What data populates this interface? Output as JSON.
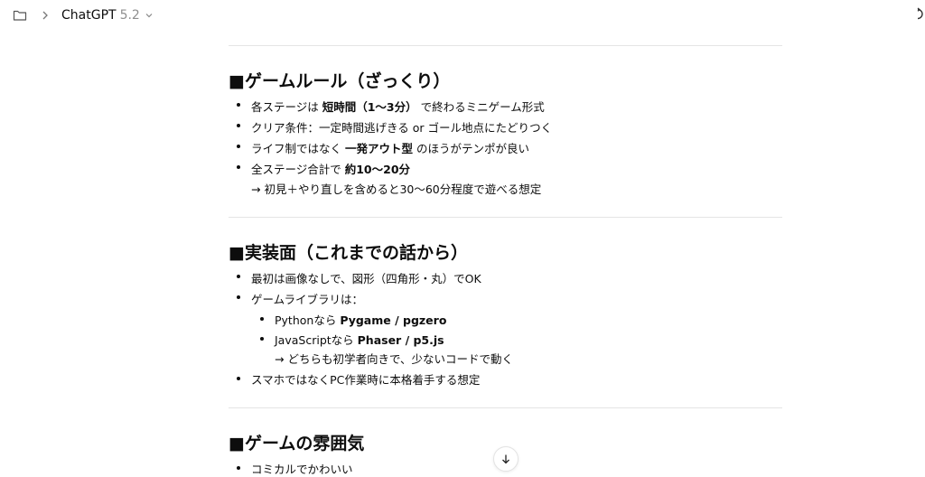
{
  "header": {
    "model_name": "ChatGPT",
    "model_version": "5.2"
  },
  "sections": [
    {
      "title": "■ゲームルール（ざっくり）",
      "items": [
        {
          "pre": "各ステージは ",
          "bold": "短時間（1〜3分）",
          "post": " で終わるミニゲーム形式"
        },
        {
          "pre": "クリア条件：一定時間逃げきる or ゴール地点にたどりつく",
          "bold": "",
          "post": ""
        },
        {
          "pre": "ライフ制ではなく ",
          "bold": "一発アウト型",
          "post": " のほうがテンポが良い"
        },
        {
          "pre": "全ステージ合計で ",
          "bold": "約10〜20分",
          "post": ""
        }
      ],
      "note": "→ 初見＋やり直しを含めると30〜60分程度で遊べる想定"
    },
    {
      "title": "■実装面（これまでの話から）",
      "items": [
        {
          "pre": "最初は画像なしで、図形（四角形・丸）でOK",
          "bold": "",
          "post": ""
        },
        {
          "pre": "ゲームライブラリは：",
          "bold": "",
          "post": ""
        }
      ],
      "subitems": [
        {
          "pre": "Pythonなら ",
          "bold": "Pygame / pgzero",
          "post": ""
        },
        {
          "pre": "JavaScriptなら ",
          "bold": "Phaser / p5.js",
          "post": ""
        }
      ],
      "subnote": "→ どちらも初学者向きで、少ないコードで動く",
      "last_item": "スマホではなくPC作業時に本格着手する想定"
    },
    {
      "title": "■ゲームの雰囲気",
      "items": [
        {
          "pre": "コミカルでかわいい",
          "bold": "",
          "post": ""
        }
      ]
    }
  ],
  "icons": {
    "folder": "folder-icon",
    "chevron_right": "chevron-right-icon",
    "chevron_down": "chevron-down-icon",
    "share": "share-icon",
    "scroll_down": "arrow-down-icon"
  }
}
